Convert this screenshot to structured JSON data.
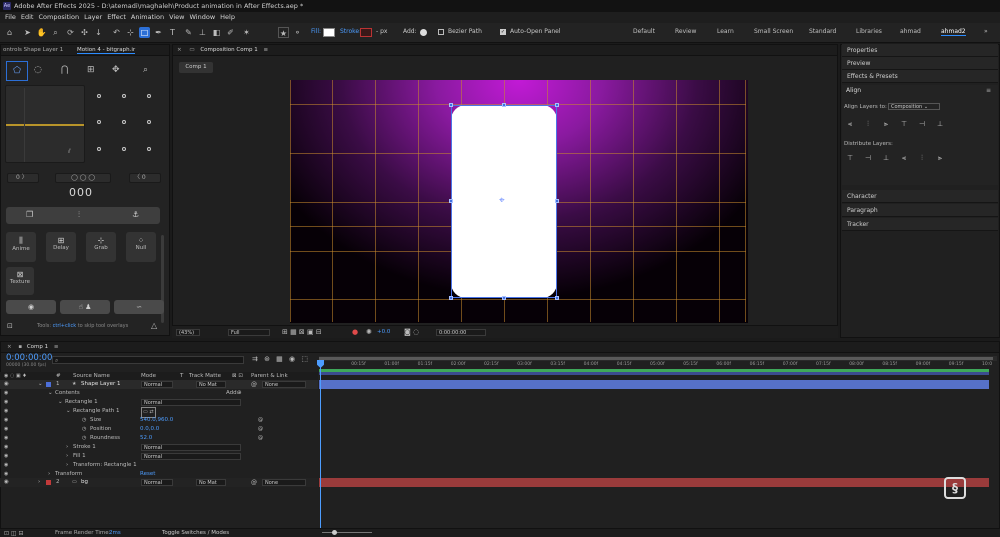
{
  "window": {
    "title": "Adobe After Effects 2025 - D:\\atemadi\\maghaleh\\Product animation in After Effects.aep *",
    "app_icon": "Ae"
  },
  "menu": [
    "File",
    "Edit",
    "Composition",
    "Layer",
    "Effect",
    "Animation",
    "View",
    "Window",
    "Help"
  ],
  "toolbar": {
    "fill_label": "Fill:",
    "stroke_label": "Stroke:",
    "stroke_px": "- px",
    "add_label": "Add:",
    "bezier_path": "Bezier Path",
    "auto_open_panel": "Auto-Open Panel",
    "workspaces": [
      "Default",
      "Review",
      "Learn",
      "Small Screen",
      "Standard",
      "Libraries",
      "ahmad",
      "ahmad2"
    ],
    "active_workspace": "ahmad2",
    "more": "»"
  },
  "left_panel": {
    "tab1": "ontrols Shape Layer 1",
    "tab2": "Motion 4 - bitgraph.ir",
    "value_left": "0",
    "value_right": "0",
    "counter": "000",
    "buttons": [
      "Anime",
      "Delay",
      "Grab",
      "Null"
    ],
    "texture": "Texture",
    "tip_prefix": "Tools:",
    "tip_key": "ctrl+click",
    "tip_suffix": "to skip tool overlays"
  },
  "comp_panel": {
    "tab": "Composition Comp 1",
    "subtab": "Comp 1",
    "zoom": "(43%)",
    "resolution": "Full",
    "exposure": "+0.0",
    "timecode": "0:00:00:00",
    "colors": {
      "shape": "#ffffff",
      "glow": "#c21ad6",
      "accent": "#2c6fd6"
    }
  },
  "right_panel": {
    "sections": [
      "Properties",
      "Preview",
      "Effects & Presets"
    ],
    "align_title": "Align",
    "align_layers_to": "Align Layers to:",
    "align_target": "Composition",
    "distribute": "Distribute Layers:",
    "bottom_sections": [
      "Character",
      "Paragraph",
      "Tracker"
    ]
  },
  "timeline": {
    "tab": "Comp 1",
    "timecode": "0:00:00:00",
    "fps": "00000 (30.00 fps)",
    "search_placeholder": "",
    "headers": {
      "num": "#",
      "source": "Source Name",
      "mode": "Mode",
      "t": "T",
      "trkmat": "Track Matte",
      "parent": "Parent & Link"
    },
    "ruler": [
      "0f",
      "00:15f",
      "01:00f",
      "01:15f",
      "02:00f",
      "02:15f",
      "03:00f",
      "03:15f",
      "04:00f",
      "04:15f",
      "05:00f",
      "05:15f",
      "06:00f",
      "06:15f",
      "07:00f",
      "07:15f",
      "08:00f",
      "08:15f",
      "09:00f",
      "09:15f",
      "10:0"
    ],
    "layers": [
      {
        "num": "1",
        "name": "Shape Layer 1",
        "mode": "Normal",
        "matte": "No Mat",
        "parent": "None",
        "color": "#4d6fd8"
      },
      {
        "num": "2",
        "name": "bg",
        "mode": "Normal",
        "matte": "No Mat",
        "parent": "None",
        "color": "#c23a3a"
      }
    ],
    "props": {
      "contents": "Contents",
      "add": "Add:",
      "rectangle": "Rectangle 1",
      "rect_mode": "Normal",
      "rect_path": "Rectangle Path 1",
      "size_label": "Size",
      "size_val": "540.0,960.0",
      "position_label": "Position",
      "position_val": "0.0,0.0",
      "roundness_label": "Roundness",
      "roundness_val": "52.0",
      "stroke": "Stroke 1",
      "stroke_mode": "Normal",
      "fill": "Fill 1",
      "fill_mode": "Normal",
      "transform_rect": "Transform: Rectangle 1",
      "transform": "Transform",
      "reset": "Reset"
    },
    "footer_render": "Frame Render Time:",
    "footer_render_val": "2ms",
    "footer_toggle": "Toggle Switches / Modes"
  }
}
